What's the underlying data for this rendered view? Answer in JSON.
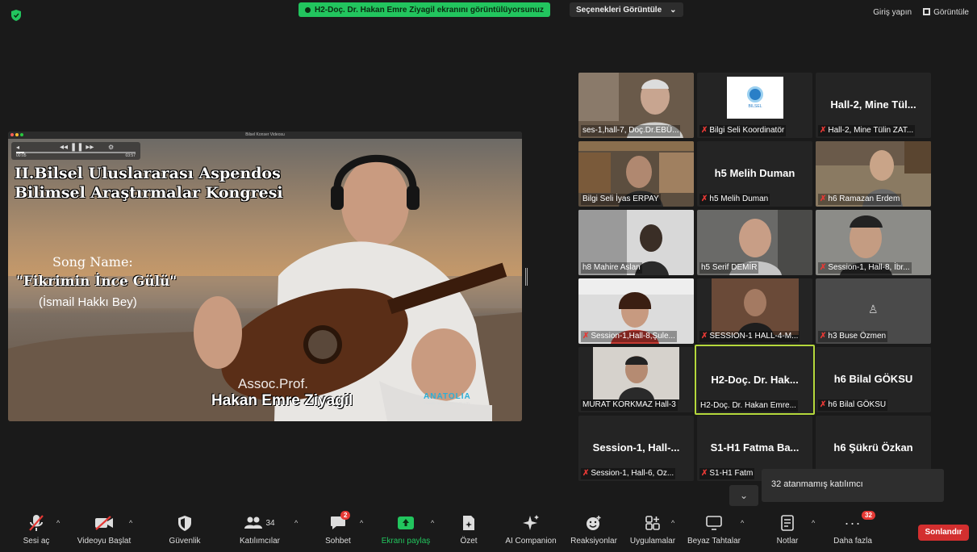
{
  "top_bar": {
    "share_banner": "H2-Doç. Dr. Hakan Emre Ziyagil ekranını görüntülüyorsunuz",
    "view_options": "Seçenekleri Görüntüle",
    "sign_in": "Giriş yapın",
    "view": "Görüntüle"
  },
  "shared_screen": {
    "window_title": "Bilsel Konser Videosu",
    "player_time_start": "00:05",
    "player_time_end": "03:57",
    "title_line1": "II.Bilsel Uluslararası Aspendos",
    "title_line2": "Bilimsel Araştırmalar Kongresi",
    "song_label": "Song Name:",
    "song_name": "\"Fikrimin İnce Gülü\"",
    "song_author": "(İsmail Hakkı Bey)",
    "performer_title": "Assoc.Prof.",
    "performer_name": "Hakan Emre Ziyagil",
    "sponsor_logo": "ANATOLIA",
    "sponsor_sub": "TRAVEL SERVICES (PVT) LTD."
  },
  "gallery": {
    "tiles": [
      {
        "label": "ses-1,hall-7, Doç.Dr.EBÜ...",
        "muted": false,
        "name": ""
      },
      {
        "label": "Bilgi Seli Koordinatör",
        "muted": true,
        "name": "",
        "logo_text": "BILSEL"
      },
      {
        "label": "Hall-2, Mine Tülin ZAT...",
        "muted": true,
        "name": "Hall-2,  Mine Tül..."
      },
      {
        "label": "Bilgi Seli İyas ERPAY",
        "muted": false,
        "name": ""
      },
      {
        "label": "h5 Melih Duman",
        "muted": true,
        "name": "h5 Melih Duman"
      },
      {
        "label": "h6 Ramazan Erdem",
        "muted": true,
        "name": ""
      },
      {
        "label": "h8 Mahire Aslan",
        "muted": false,
        "name": ""
      },
      {
        "label": "h5 Serif DEMİR",
        "muted": false,
        "name": ""
      },
      {
        "label": "Session-1, Hall-8, İbr...",
        "muted": true,
        "name": ""
      },
      {
        "label": "Session-1,Hall-8,Şule...",
        "muted": true,
        "name": ""
      },
      {
        "label": "SESSION-1 HALL-4-M...",
        "muted": true,
        "name": ""
      },
      {
        "label": "h3 Buse Özmen",
        "muted": true,
        "name": ""
      },
      {
        "label": "MURAT KORKMAZ Hall-3",
        "muted": false,
        "name": ""
      },
      {
        "label": "H2-Doç. Dr. Hakan Emre...",
        "muted": false,
        "name": "H2-Doç. Dr. Hak..."
      },
      {
        "label": "h6 Bilal GÖKSU",
        "muted": true,
        "name": "h6 Bilal GÖKSU"
      },
      {
        "label": "Session-1, Hall-6, Oz...",
        "muted": true,
        "name": "Session-1,  Hall-..."
      },
      {
        "label": "S1-H1 Fatm",
        "muted": true,
        "name": "S1-H1 Fatma Ba..."
      },
      {
        "label": "",
        "muted": false,
        "name": "h6 Şükrü Özkan"
      }
    ],
    "tooltip": "32 atanmamış katılımcı"
  },
  "toolbar": {
    "mute": "Sesi aç",
    "video": "Videoyu Başlat",
    "security": "Güvenlik",
    "participants": "Katılımcılar",
    "participants_count": "34",
    "chat": "Sohbet",
    "chat_badge": "2",
    "share": "Ekranı paylaş",
    "summary": "Özet",
    "ai": "AI Companion",
    "reactions": "Reaksiyonlar",
    "apps": "Uygulamalar",
    "whiteboards": "Beyaz Tahtalar",
    "notes": "Notlar",
    "more": "Daha fazla",
    "more_badge": "32",
    "end": "Sonlandır"
  },
  "colors": {
    "share_green": "#22c55e",
    "end_red": "#d32f2f",
    "active_speaker": "#b5d83c",
    "background": "#1a1a1a"
  }
}
